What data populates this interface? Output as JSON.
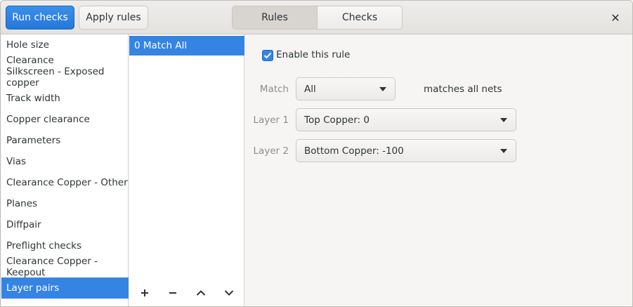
{
  "header": {
    "run_checks": "Run checks",
    "apply_rules": "Apply rules",
    "tabs": [
      "Rules",
      "Checks"
    ],
    "active_tab": "Rules",
    "close": "✕"
  },
  "rule_categories": [
    {
      "label": "Hole size"
    },
    {
      "label": "Clearance\nSilkscreen - Exposed copper"
    },
    {
      "label": "Track width"
    },
    {
      "label": "Copper clearance"
    },
    {
      "label": "Parameters"
    },
    {
      "label": "Vias"
    },
    {
      "label": "Clearance Copper - Other"
    },
    {
      "label": "Planes"
    },
    {
      "label": "Diffpair"
    },
    {
      "label": "Preflight checks"
    },
    {
      "label": "Clearance Copper - Keepout"
    },
    {
      "label": "Layer pairs"
    }
  ],
  "selected_category": "Layer pairs",
  "rules": [
    {
      "label": "0 Match All"
    }
  ],
  "rule_toolbar": {
    "add": "+",
    "remove": "−",
    "up": "^",
    "down": "v"
  },
  "editor": {
    "enable_label": "Enable this rule",
    "enabled": true,
    "match_label": "Match",
    "match_value": "All",
    "match_info": "matches all nets",
    "layer1_label": "Layer 1",
    "layer1_value": "Top Copper: 0",
    "layer2_label": "Layer 2",
    "layer2_value": "Bottom Copper: -100"
  },
  "colors": {
    "accent": "#3584e4",
    "primary_button": "#2f86e6"
  }
}
